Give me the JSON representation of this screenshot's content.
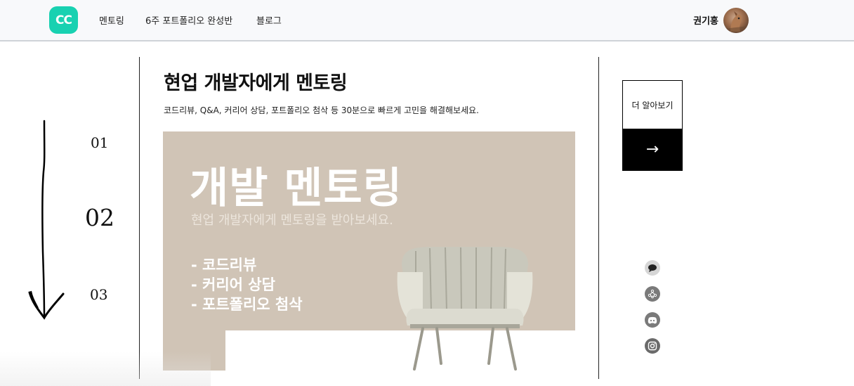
{
  "header": {
    "logo_text": "CC",
    "nav": [
      "멘토링",
      "6주 포트폴리오 완성반",
      "블로그"
    ],
    "user_name": "권기홍"
  },
  "steps": [
    "01",
    "02",
    "03"
  ],
  "main": {
    "title": "현업 개발자에게 멘토링",
    "description": "코드리뷰, Q&A, 커리어 상담, 포트폴리오 첨삭 등 30분으로 빠르게 고민을 해결해보세요."
  },
  "banner": {
    "title": "개발 멘토링",
    "subtitle": "현업 개발자에게 멘토링을 받아보세요.",
    "bullets": [
      "- 코드리뷰",
      "- 커리어 상담",
      "- 포트폴리오 첨삭"
    ]
  },
  "cta": {
    "label": "더 알아보기",
    "arrow": "→"
  },
  "social_icons": [
    "chat-bubble-icon",
    "network-icon",
    "discord-icon",
    "instagram-icon"
  ],
  "colors": {
    "brand": "#18d1b1",
    "banner_bg": "#d0c4b6"
  }
}
